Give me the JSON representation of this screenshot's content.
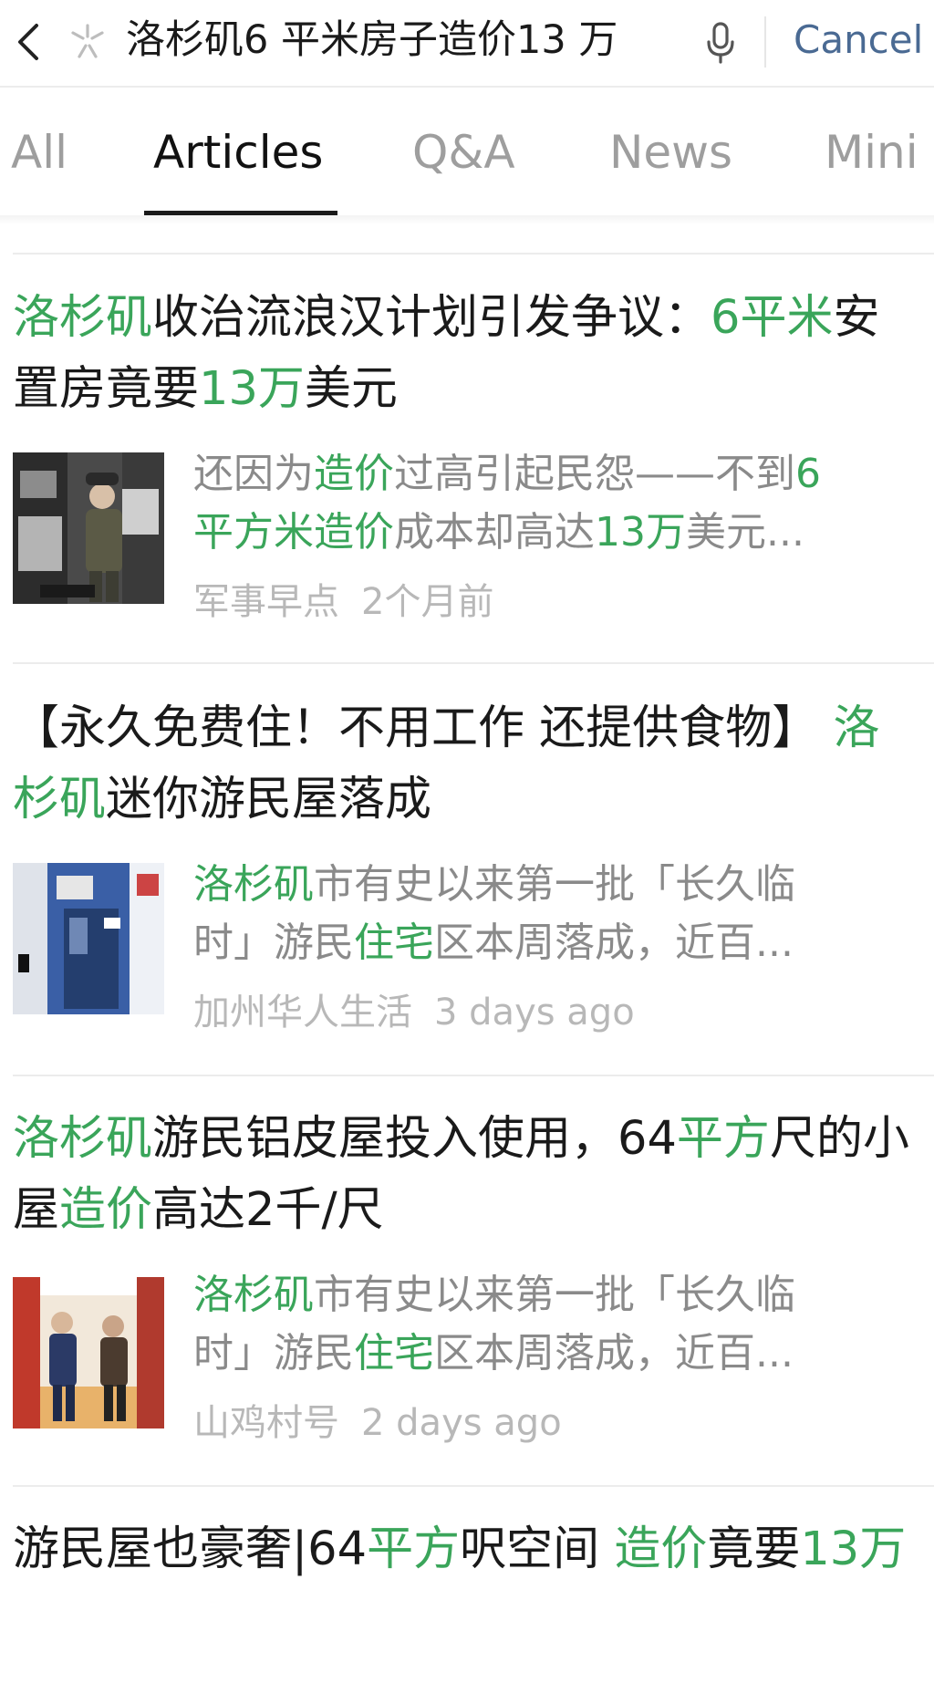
{
  "search": {
    "query": "洛杉矶6 平米房子造价13 万",
    "cancel_label": "Cancel"
  },
  "tabs": [
    {
      "label": "All"
    },
    {
      "label": "Articles"
    },
    {
      "label": "Q&A"
    },
    {
      "label": "News"
    },
    {
      "label": "Mini"
    }
  ],
  "results": [
    {
      "title_parts": [
        {
          "text": "洛杉矶",
          "hl": true
        },
        {
          "text": "收治流浪汉计划引发争议：",
          "hl": false
        },
        {
          "text": "6平米",
          "hl": true
        },
        {
          "text": "安置房竟要",
          "hl": false
        },
        {
          "text": "13万",
          "hl": true
        },
        {
          "text": "美元",
          "hl": false
        }
      ],
      "snippet_line1": [
        {
          "text": "还因为",
          "hl": false
        },
        {
          "text": "造价",
          "hl": true
        },
        {
          "text": "过高引起民怨——不到",
          "hl": false
        },
        {
          "text": "6",
          "hl": true
        }
      ],
      "snippet_line2": [
        {
          "text": "平方米造价",
          "hl": true
        },
        {
          "text": "成本却高达",
          "hl": false
        },
        {
          "text": "13万",
          "hl": true
        },
        {
          "text": "美元...",
          "hl": false
        }
      ],
      "source": "军事早点",
      "time": "2个月前"
    },
    {
      "title_parts": [
        {
          "text": "【永久免费住！不用工作 还提供食物】 ",
          "hl": false
        },
        {
          "text": "洛杉矶",
          "hl": true
        },
        {
          "text": "迷你游民屋落成",
          "hl": false
        }
      ],
      "snippet_line1": [
        {
          "text": "洛杉矶",
          "hl": true
        },
        {
          "text": "市有史以来第一批「长久临",
          "hl": false
        }
      ],
      "snippet_line2": [
        {
          "text": "时」游民",
          "hl": false
        },
        {
          "text": "住宅",
          "hl": true
        },
        {
          "text": "区本周落成，近百...",
          "hl": false
        }
      ],
      "source": "加州华人生活",
      "time": "3 days ago"
    },
    {
      "title_parts": [
        {
          "text": "洛杉矶",
          "hl": true
        },
        {
          "text": "游民铝皮屋投入使用，64",
          "hl": false
        },
        {
          "text": "平方",
          "hl": true
        },
        {
          "text": "尺的小屋",
          "hl": false
        },
        {
          "text": "造价",
          "hl": true
        },
        {
          "text": "高达2千/尺",
          "hl": false
        }
      ],
      "snippet_line1": [
        {
          "text": "洛杉矶",
          "hl": true
        },
        {
          "text": "市有史以来第一批「长久临",
          "hl": false
        }
      ],
      "snippet_line2": [
        {
          "text": "时」游民",
          "hl": false
        },
        {
          "text": "住宅",
          "hl": true
        },
        {
          "text": "区本周落成，近百...",
          "hl": false
        }
      ],
      "source": "山鸡村号",
      "time": "2 days ago"
    },
    {
      "title_parts": [
        {
          "text": "游民屋也豪奢|64",
          "hl": false
        },
        {
          "text": "平方",
          "hl": true
        },
        {
          "text": "呎空间 ",
          "hl": false
        },
        {
          "text": "造价",
          "hl": true
        },
        {
          "text": "竟要",
          "hl": false
        },
        {
          "text": "13万",
          "hl": true
        }
      ]
    }
  ],
  "colors": {
    "highlight": "#3aa55a",
    "cancel": "#4a6a93",
    "muted": "#8a8a8a",
    "meta": "#b8b8b8"
  },
  "icons": [
    "back-chevron-icon",
    "wechat-search-logo-icon",
    "microphone-icon"
  ]
}
